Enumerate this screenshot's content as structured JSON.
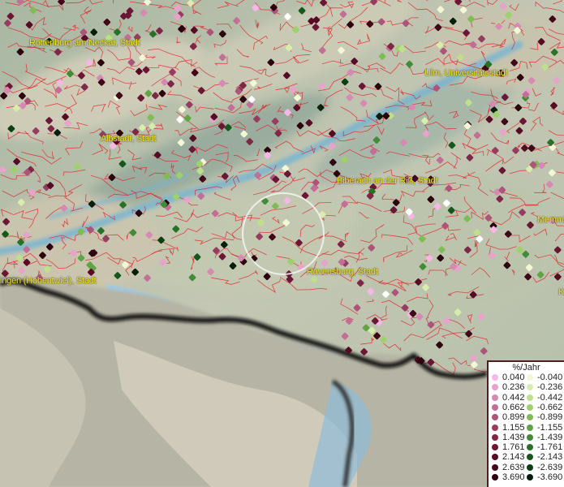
{
  "map": {
    "city_labels": [
      "Rottenburg am Neckar, Stadt",
      "Ulm, Universitätsstadt",
      "Albstadt, Stadt",
      "Biberach an der Riß, Stadt",
      "Memmi",
      "Ravensburg, Stadt",
      "ingen (Hohentwiel), Stadt",
      "K"
    ],
    "colors": {
      "boundary": "#e2232a",
      "river": "#6fb4d4",
      "lake": "#9ec9e6",
      "border": "#1a1a1a",
      "selection_ring": "#f4f4f4"
    }
  },
  "legend": {
    "title": "%/Jahr",
    "positive": [
      {
        "value": "0.040",
        "color": "#f5b8e6"
      },
      {
        "value": "0.236",
        "color": "#e8a2cc"
      },
      {
        "value": "0.442",
        "color": "#d689b2"
      },
      {
        "value": "0.662",
        "color": "#c26e96"
      },
      {
        "value": "0.899",
        "color": "#ac5479"
      },
      {
        "value": "1.155",
        "color": "#963c5f"
      },
      {
        "value": "1.439",
        "color": "#7f2747"
      },
      {
        "value": "1.761",
        "color": "#6a1634"
      },
      {
        "value": "2.143",
        "color": "#560a24"
      },
      {
        "value": "2.639",
        "color": "#420417"
      },
      {
        "value": "3.690",
        "color": "#2a010c"
      }
    ],
    "negative": [
      {
        "value": "-0.040",
        "color": "#f2f7d6"
      },
      {
        "value": "-0.236",
        "color": "#d8edac"
      },
      {
        "value": "-0.442",
        "color": "#bfe08a"
      },
      {
        "value": "-0.662",
        "color": "#9fd06c"
      },
      {
        "value": "-0.899",
        "color": "#7fbc56"
      },
      {
        "value": "-1.155",
        "color": "#5fa545"
      },
      {
        "value": "-1.439",
        "color": "#418c36"
      },
      {
        "value": "-1.761",
        "color": "#287228"
      },
      {
        "value": "-2.143",
        "color": "#14581b"
      },
      {
        "value": "-2.639",
        "color": "#0a3f12"
      },
      {
        "value": "-3.690",
        "color": "#031f08"
      }
    ]
  }
}
